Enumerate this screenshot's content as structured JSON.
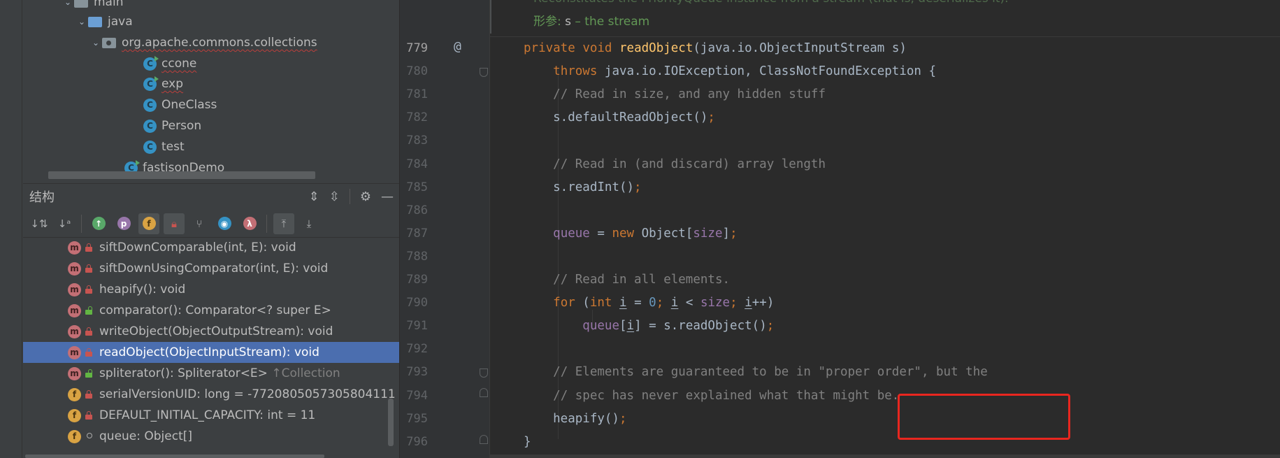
{
  "project_tree": {
    "items": [
      {
        "label": "main",
        "kind": "folder"
      },
      {
        "label": "java",
        "kind": "folder-blue"
      },
      {
        "label": "org.apache.commons.collections",
        "kind": "package"
      },
      {
        "label": "ccone",
        "kind": "class-run"
      },
      {
        "label": "exp",
        "kind": "class-run"
      },
      {
        "label": "OneClass",
        "kind": "class"
      },
      {
        "label": "Person",
        "kind": "class"
      },
      {
        "label": "test",
        "kind": "class"
      },
      {
        "label": "fastjsonDemo",
        "kind": "class-run"
      }
    ],
    "class_icon_letter": "C"
  },
  "structure": {
    "title": "结构",
    "toolbar_letters": {
      "p": "p",
      "f": "f",
      "lambda": "λ"
    },
    "items": [
      {
        "icon": "m",
        "access": "private",
        "label": "siftDownComparable(int, E): void"
      },
      {
        "icon": "m",
        "access": "private",
        "label": "siftDownUsingComparator(int, E): void"
      },
      {
        "icon": "m",
        "access": "private",
        "label": "heapify(): void"
      },
      {
        "icon": "m",
        "access": "public",
        "label": "comparator(): Comparator<? super E>"
      },
      {
        "icon": "m",
        "access": "private",
        "label": "writeObject(ObjectOutputStream): void"
      },
      {
        "icon": "m",
        "access": "private",
        "label": "readObject(ObjectInputStream): void",
        "selected": true
      },
      {
        "icon": "m",
        "access": "public",
        "label": "spliterator(): Spliterator<E>",
        "suffix": "↑Collection"
      },
      {
        "icon": "f",
        "access": "private",
        "label": "serialVersionUID: long = -7720805057305804111"
      },
      {
        "icon": "f",
        "access": "private",
        "label": "DEFAULT_INITIAL_CAPACITY: int = 11"
      },
      {
        "icon": "f",
        "access": "package",
        "label": "queue: Object[]"
      }
    ]
  },
  "editor": {
    "doc_faded": "Reconstitutes the PriorityQueue instance from a stream (that is, deserializes it).",
    "doc_param_label": "形参:",
    "doc_param_name": "s",
    "doc_param_desc": " – the stream",
    "override_marker": "@",
    "line_numbers": [
      "779",
      "780",
      "781",
      "782",
      "783",
      "784",
      "785",
      "786",
      "787",
      "788",
      "789",
      "790",
      "791",
      "792",
      "793",
      "794",
      "795",
      "796"
    ],
    "lines": [
      {
        "t": "private void readObject(java.io.ObjectInputStream s)"
      },
      {
        "t": "    throws java.io.IOException, ClassNotFoundException {"
      },
      {
        "t": "    // Read in size, and any hidden stuff"
      },
      {
        "t": "    s.defaultReadObject();"
      },
      {
        "t": ""
      },
      {
        "t": "    // Read in (and discard) array length"
      },
      {
        "t": "    s.readInt();"
      },
      {
        "t": ""
      },
      {
        "t": "    queue = new Object[size];"
      },
      {
        "t": ""
      },
      {
        "t": "    // Read in all elements."
      },
      {
        "t": "    for (int i = 0; i < size; i++)"
      },
      {
        "t": "        queue[i] = s.readObject();"
      },
      {
        "t": ""
      },
      {
        "t": "    // Elements are guaranteed to be in \"proper order\", but the"
      },
      {
        "t": "    // spec has never explained what that might be."
      },
      {
        "t": "    heapify();"
      },
      {
        "t": "}"
      }
    ]
  },
  "colors": {
    "keyword": "#cc7832",
    "method_decl": "#ffc66d",
    "comment": "#808080",
    "field": "#9876aa",
    "number": "#6897bb",
    "selection": "#4b6eaf",
    "highlight_box": "#e8261f"
  }
}
